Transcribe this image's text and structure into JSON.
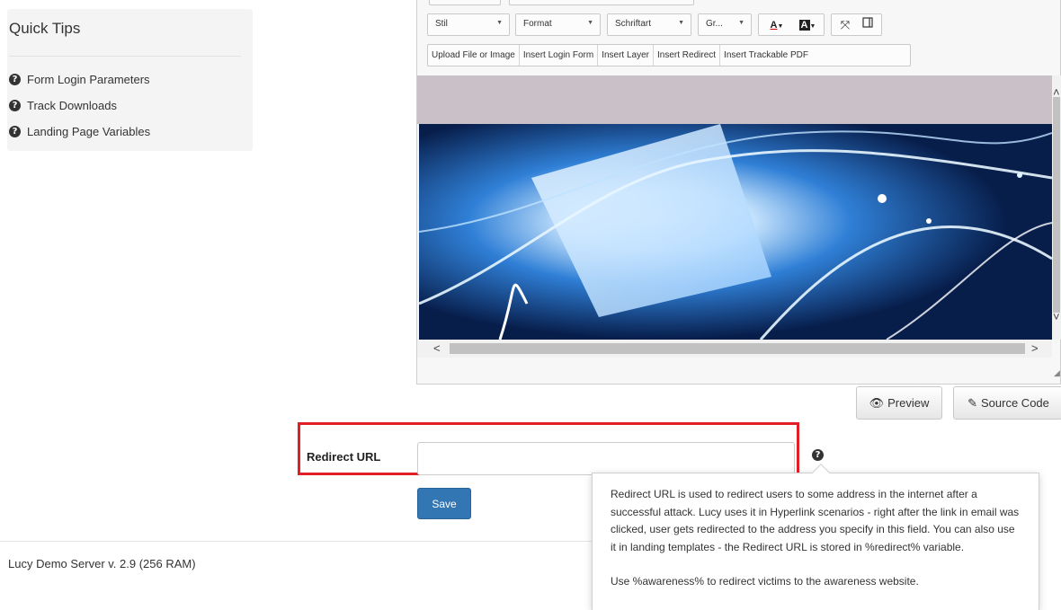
{
  "quick_tips": {
    "title": "Quick Tips",
    "items": [
      {
        "label": "Form Login Parameters",
        "icon": "question-circle-icon"
      },
      {
        "label": "Track Downloads",
        "icon": "question-circle-icon"
      },
      {
        "label": "Landing Page Variables",
        "icon": "question-circle-icon"
      }
    ]
  },
  "editor": {
    "toolbar": {
      "style_combo": "Stil",
      "format_combo": "Format",
      "font_combo": "Schriftart",
      "size_combo": "Gr...",
      "text_color_label": "A",
      "bg_color_label": "A",
      "maximize_icon": "maximize-icon",
      "show_blocks_icon": "show-blocks-icon"
    },
    "insert_buttons": [
      "Upload File or Image",
      "Insert Login Form",
      "Insert Layer",
      "Insert Redirect",
      "Insert Trackable PDF"
    ],
    "preview_label": "Preview",
    "source_code_label": "Source Code"
  },
  "redirect": {
    "label": "Redirect URL",
    "value": "",
    "save_label": "Save"
  },
  "tooltip": {
    "paragraph1": "Redirect URL is used to redirect users to some address in the internet after a successful attack. Lucy uses it in Hyperlink scenarios - right after the link in email was clicked, user gets redirected to the address you specify in this field. You can also use it in landing templates - the Redirect URL is stored in %redirect% variable.",
    "paragraph2": "Use %awareness% to redirect victims to the awareness website."
  },
  "footer": {
    "version": "Lucy Demo Server v. 2.9 (256 RAM)"
  },
  "colors": {
    "highlight_border": "#e21e27",
    "save_button": "#3376b4",
    "canvas_gray": "#c9c1c7"
  }
}
